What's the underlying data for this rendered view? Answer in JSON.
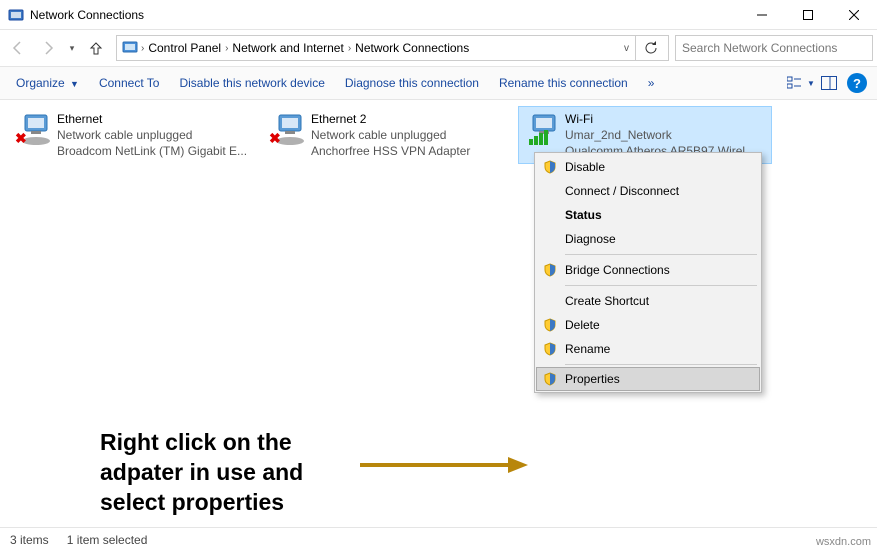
{
  "window": {
    "title": "Network Connections",
    "min_tip": "Minimize",
    "max_tip": "Maximize",
    "close_tip": "Close"
  },
  "breadcrumb": {
    "root_icon": "control-panel",
    "items": [
      "Control Panel",
      "Network and Internet",
      "Network Connections"
    ]
  },
  "search": {
    "placeholder": "Search Network Connections"
  },
  "toolbar": {
    "organize": "Organize",
    "connect_to": "Connect To",
    "disable": "Disable this network device",
    "diagnose": "Diagnose this connection",
    "rename": "Rename this connection",
    "more": "»"
  },
  "adapters": [
    {
      "name": "Ethernet",
      "status": "Network cable unplugged",
      "device": "Broadcom NetLink (TM) Gigabit E...",
      "state": "unplugged",
      "selected": false
    },
    {
      "name": "Ethernet 2",
      "status": "Network cable unplugged",
      "device": "Anchorfree HSS VPN Adapter",
      "state": "unplugged",
      "selected": false
    },
    {
      "name": "Wi-Fi",
      "status": "Umar_2nd_Network",
      "device": "Qualcomm Atheros AR5B97 Wirel...",
      "state": "connected",
      "selected": true
    }
  ],
  "context_menu": {
    "items": [
      {
        "label": "Disable",
        "shield": true
      },
      {
        "label": "Connect / Disconnect",
        "shield": false
      },
      {
        "label": "Status",
        "shield": false,
        "bold": true
      },
      {
        "label": "Diagnose",
        "shield": false
      },
      {
        "sep": true
      },
      {
        "label": "Bridge Connections",
        "shield": true
      },
      {
        "sep": true
      },
      {
        "label": "Create Shortcut",
        "shield": false
      },
      {
        "label": "Delete",
        "shield": true
      },
      {
        "label": "Rename",
        "shield": true
      },
      {
        "sep": true
      },
      {
        "label": "Properties",
        "shield": true,
        "selected": true
      }
    ]
  },
  "annotation": {
    "line1": "Right click on the",
    "line2": "adpater in use and",
    "line3": "select properties"
  },
  "statusbar": {
    "count": "3 items",
    "selected": "1 item selected"
  },
  "watermark": "wsxdn.com"
}
